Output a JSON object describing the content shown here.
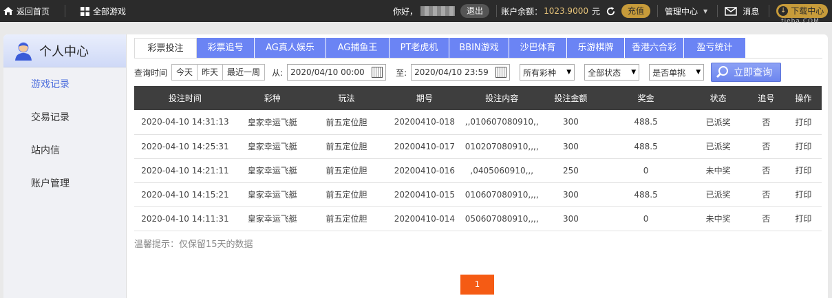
{
  "topbar": {
    "home_label": "返回首页",
    "games_label": "全部游戏",
    "hello_label": "你好，",
    "logout_label": "退出",
    "balance_label": "账户余额：",
    "balance_value": "1023.9000",
    "currency": "元",
    "recharge_label": "充值",
    "manage_label": "管理中心",
    "message_label": "消息",
    "download_label": "下载中心"
  },
  "watermark": "tieba.COM",
  "sidebar": {
    "title": "个人中心",
    "items": [
      {
        "label": "游戏记录",
        "active": true
      },
      {
        "label": "交易记录"
      },
      {
        "label": "站内信"
      },
      {
        "label": "账户管理"
      }
    ]
  },
  "tabs": [
    {
      "label": "彩票投注",
      "active": true
    },
    {
      "label": "彩票追号"
    },
    {
      "label": "AG真人娱乐"
    },
    {
      "label": "AG捕鱼王"
    },
    {
      "label": "PT老虎机"
    },
    {
      "label": "BBIN游戏"
    },
    {
      "label": "沙巴体育"
    },
    {
      "label": "乐游棋牌"
    },
    {
      "label": "香港六合彩"
    },
    {
      "label": "盈亏统计"
    }
  ],
  "filters": {
    "time_label": "查询时间",
    "quick": [
      "今天",
      "昨天",
      "最近一周"
    ],
    "from_label": "从:",
    "from_value": "2020/04/10 00:00",
    "to_label": "至:",
    "to_value": "2020/04/10 23:59",
    "lottery_select": "所有彩种",
    "status_select": "全部状态",
    "single_select": "是否单挑",
    "query_button": "立即查询"
  },
  "table": {
    "headers": [
      "投注时间",
      "彩种",
      "玩法",
      "期号",
      "投注内容",
      "投注金额",
      "奖金",
      "状态",
      "追号",
      "操作"
    ],
    "rows": [
      [
        "2020-04-10 14:31:13",
        "皇家幸运飞艇",
        "前五定位胆",
        "20200410-018",
        ",,010607080910,,",
        "300",
        "488.5",
        "已派奖",
        "否",
        "打印"
      ],
      [
        "2020-04-10 14:25:31",
        "皇家幸运飞艇",
        "前五定位胆",
        "20200410-017",
        "010207080910,,,,",
        "300",
        "488.5",
        "已派奖",
        "否",
        "打印"
      ],
      [
        "2020-04-10 14:21:11",
        "皇家幸运飞艇",
        "前五定位胆",
        "20200410-016",
        ",0405060910,,,",
        "250",
        "0",
        "未中奖",
        "否",
        "打印"
      ],
      [
        "2020-04-10 14:15:21",
        "皇家幸运飞艇",
        "前五定位胆",
        "20200410-015",
        "010607080910,,,,",
        "300",
        "488.5",
        "已派奖",
        "否",
        "打印"
      ],
      [
        "2020-04-10 14:11:31",
        "皇家幸运飞艇",
        "前五定位胆",
        "20200410-014",
        "050607080910,,,,",
        "300",
        "0",
        "未中奖",
        "否",
        "打印"
      ]
    ]
  },
  "tip": "温馨提示：仅保留15天的数据",
  "pager": {
    "current": "1"
  },
  "colors": {
    "accent": "#6b84f4",
    "win": "#e0393a",
    "pager": "#f55b14"
  }
}
